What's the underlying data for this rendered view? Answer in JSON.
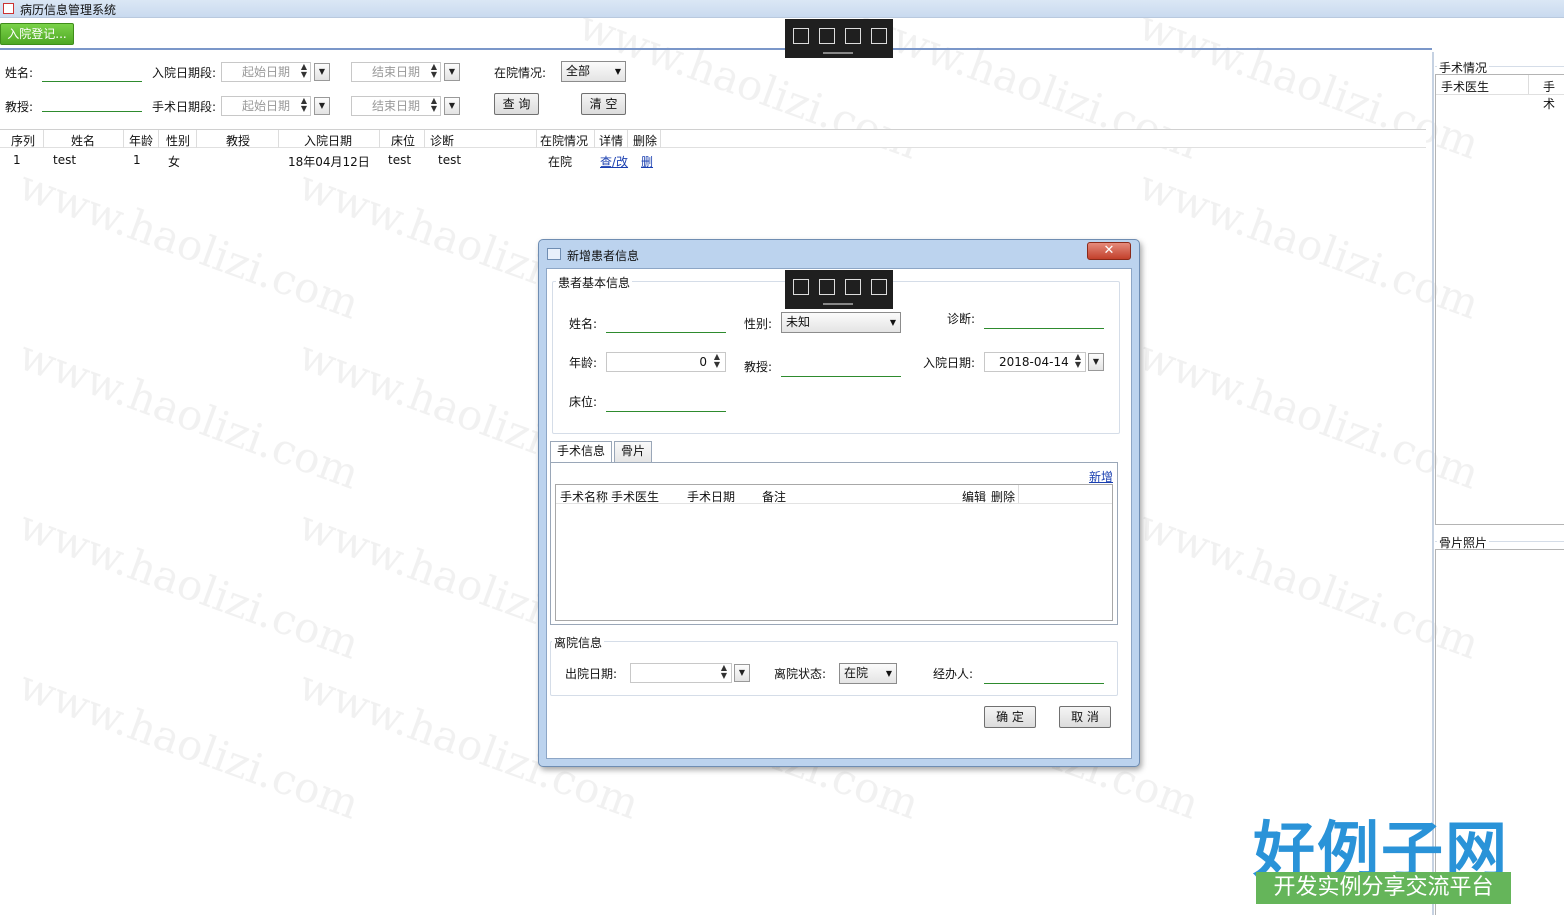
{
  "window": {
    "title": "病历信息管理系统"
  },
  "toolbar": {
    "admit_button": "入院登记..."
  },
  "search": {
    "name_label": "姓名:",
    "professor_label": "教授:",
    "admit_period_label": "入院日期段:",
    "surgery_period_label": "手术日期段:",
    "start_placeholder": "起始日期",
    "end_placeholder": "结束日期",
    "status_label": "在院情况:",
    "status_value": "全部",
    "query_button": "查 询",
    "clear_button": "清 空"
  },
  "grid": {
    "columns": [
      "序列",
      "姓名",
      "年龄",
      "性别",
      "教授",
      "入院日期",
      "床位",
      "诊断",
      "在院情况",
      "详情",
      "删除"
    ],
    "rows": [
      {
        "seq": "1",
        "name": "test",
        "age": "1",
        "gender": "女",
        "professor": "",
        "admit_date": "18年04月12日",
        "bed": "test",
        "diagnosis": "test",
        "status": "在院",
        "detail": "查/改",
        "delete": "删"
      }
    ]
  },
  "right_panel": {
    "surgery_title": "手术情况",
    "surgery_columns": [
      "手术医生",
      "手术"
    ],
    "xray_title": "骨片照片"
  },
  "dialog": {
    "title": "新增患者信息",
    "basic_group": "患者基本信息",
    "name_label": "姓名:",
    "gender_label": "性别:",
    "gender_value": "未知",
    "diagnosis_label": "诊断:",
    "age_label": "年龄:",
    "age_value": "0",
    "professor_label": "教授:",
    "admit_date_label": "入院日期:",
    "admit_date_value": "2018-04-14",
    "bed_label": "床位:",
    "tabs": [
      "手术信息",
      "骨片"
    ],
    "add_link": "新增",
    "surgery_columns": [
      "手术名称",
      "手术医生",
      "手术日期",
      "备注",
      "编辑",
      "删除"
    ],
    "discharge_group": "离院信息",
    "discharge_date_label": "出院日期:",
    "discharge_status_label": "离院状态:",
    "discharge_status_value": "在院",
    "handler_label": "经办人:",
    "ok_button": "确 定",
    "cancel_button": "取 消"
  },
  "watermark_text": "www.haolizi.com",
  "brand": {
    "logo": "好例子网",
    "slogan": "开发实例分享交流平台"
  }
}
